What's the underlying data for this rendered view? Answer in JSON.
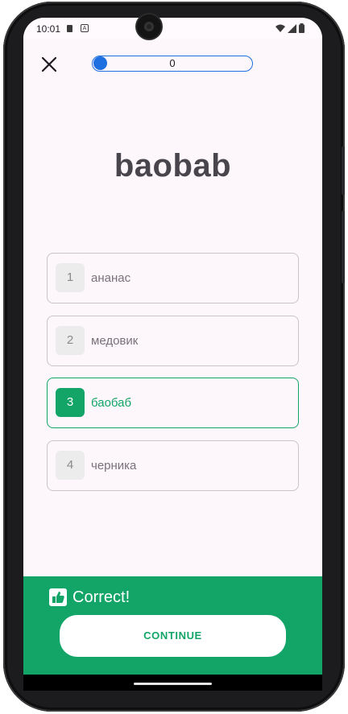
{
  "status_bar": {
    "time": "10:01",
    "sd_icon": "sd-card-icon",
    "a_icon": "a-icon",
    "a_glyph": "A",
    "wifi_icon": "wifi-icon",
    "signal_icon": "signal-icon",
    "battery_icon": "battery-icon"
  },
  "top_bar": {
    "close_icon": "close-icon",
    "progress_value": 0,
    "progress_label": "0",
    "progress_color": "#1e6fe0"
  },
  "quiz": {
    "word": "baobab",
    "options": [
      {
        "number": "1",
        "text": "ананас",
        "state": "default"
      },
      {
        "number": "2",
        "text": "медовик",
        "state": "default"
      },
      {
        "number": "3",
        "text": "баобаб",
        "state": "correct"
      },
      {
        "number": "4",
        "text": "черника",
        "state": "default"
      }
    ]
  },
  "feedback": {
    "icon": "thumbs-up-icon",
    "message": "Correct!",
    "continue_label": "CONTINUE",
    "color": "#13a567"
  }
}
